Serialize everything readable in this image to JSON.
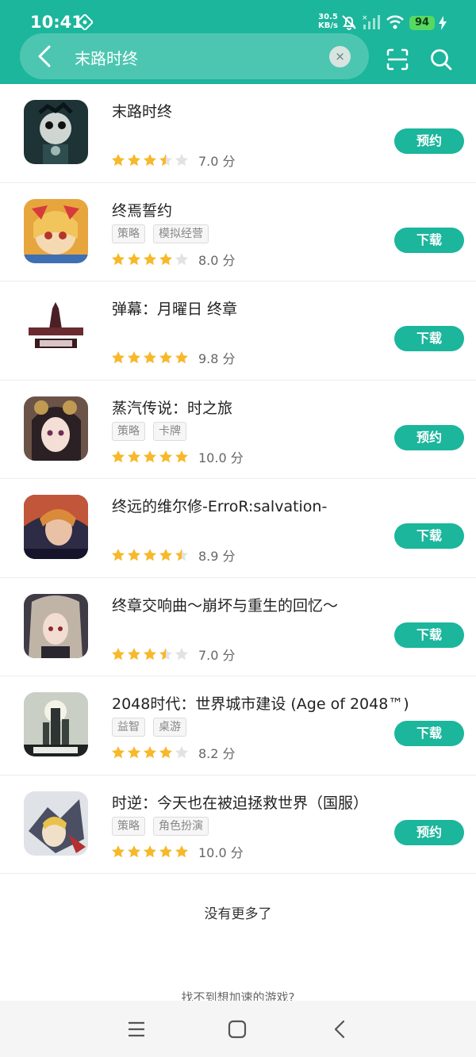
{
  "status_bar": {
    "time": "10:41",
    "speed_value": "30.5",
    "speed_unit": "KB/s",
    "battery": "94"
  },
  "search": {
    "query": "末路时终",
    "clear_symbol": "×"
  },
  "colors": {
    "accent": "#1bb69c",
    "star_filled": "#f7b82b",
    "star_empty": "#e2e2e2"
  },
  "results": [
    {
      "title": "末路时终",
      "tags": [],
      "stars": 3.5,
      "score": "7.0 分",
      "action": "预约"
    },
    {
      "title": "终焉誓约",
      "tags": [
        "策略",
        "模拟经营"
      ],
      "stars": 4,
      "score": "8.0 分",
      "action": "下载"
    },
    {
      "title": "弹幕：月曜日 终章",
      "tags": [],
      "stars": 5,
      "score": "9.8 分",
      "action": "下载"
    },
    {
      "title": "蒸汽传说：时之旅",
      "tags": [
        "策略",
        "卡牌"
      ],
      "stars": 5,
      "score": "10.0 分",
      "action": "预约"
    },
    {
      "title": "终远的维尔修-ErroR:salvation-",
      "tags": [],
      "stars": 4.5,
      "score": "8.9 分",
      "action": "下载"
    },
    {
      "title": "终章交响曲～崩坏与重生的回忆～",
      "tags": [],
      "stars": 3.5,
      "score": "7.0 分",
      "action": "下载"
    },
    {
      "title": "2048时代：世界城市建设 (Age of 2048™)",
      "tags": [
        "益智",
        "桌游"
      ],
      "stars": 4,
      "score": "8.2 分",
      "action": "下载"
    },
    {
      "title": "时逆：今天也在被迫拯救世界（国服）",
      "tags": [
        "策略",
        "角色扮演"
      ],
      "stars": 5,
      "score": "10.0 分",
      "action": "预约"
    }
  ],
  "footer": {
    "no_more": "没有更多了",
    "not_found": "找不到想加速的游戏?"
  }
}
